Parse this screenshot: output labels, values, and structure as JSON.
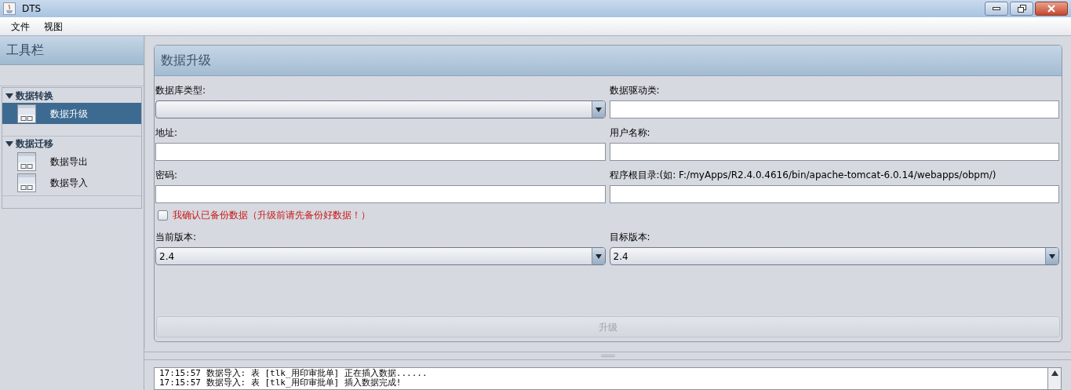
{
  "window": {
    "title": "DTS"
  },
  "menu": [
    "文件",
    "视图"
  ],
  "sidebar": {
    "title": "工具栏",
    "groups": [
      {
        "label": "数据转换",
        "expanded": true,
        "children": [
          {
            "label": "数据升级",
            "selected": true
          }
        ]
      },
      {
        "label": "数据迁移",
        "expanded": true,
        "children": [
          {
            "label": "数据导出",
            "selected": false
          },
          {
            "label": "数据导入",
            "selected": false
          }
        ]
      }
    ]
  },
  "panel": {
    "title": "数据升级",
    "fields": [
      {
        "kind": "combo",
        "label": "数据库类型:"
      },
      {
        "kind": "text",
        "label": "数据驱动类:"
      },
      {
        "kind": "text",
        "label": "地址:"
      },
      {
        "kind": "text",
        "label": "用户名称:"
      },
      {
        "kind": "text",
        "label": "密码:"
      },
      {
        "kind": "text",
        "label": "程序根目录:(如: F:/myApps/R2.4.0.4616/bin/apache-tomcat-6.0.14/webapps/obpm/)"
      }
    ],
    "backup_confirm": {
      "label": "我确认已备份数据（升级前请先备份好数据！）",
      "checked": false
    },
    "version_fields": [
      {
        "kind": "combo",
        "label": "当前版本:",
        "value": "2.4"
      },
      {
        "kind": "combo",
        "label": "目标版本:",
        "value": "2.4"
      }
    ],
    "upgrade_button": {
      "label": "升级",
      "disabled": true
    }
  },
  "log": [
    "17:15:57 数据导入: 表 [tlk_用印审批单] 正在插入数据......",
    "17:15:57 数据导入: 表 [tlk_用印审批单] 插入数据完成!"
  ]
}
